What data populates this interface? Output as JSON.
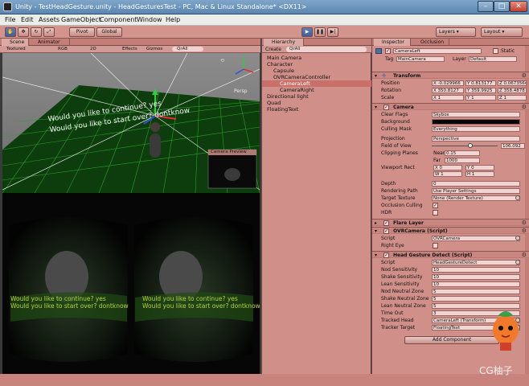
{
  "window": {
    "title": "Unity - TestHeadGesture.unity - HeadGesturesTest - PC, Mac & Linux Standalone* <DX11>"
  },
  "menu": [
    "File",
    "Edit",
    "Assets",
    "GameObject",
    "Component",
    "Window",
    "Help"
  ],
  "toolbar": {
    "pivot": "Pivot",
    "global": "Global",
    "layers": "Layers",
    "layout": "Layout"
  },
  "scene": {
    "tabs": [
      "Scene",
      "Animator"
    ],
    "options": {
      "shading": "Textured",
      "render": "RGB",
      "mode2d": "2D",
      "effects": "Effects",
      "gizmos": "Gizmos",
      "search": "QrAll"
    },
    "persp": "Persp",
    "text_line1": "Would you like to continue? yes",
    "text_line2": "Would you like to start over? dontknow",
    "camera_preview": "Camera Preview"
  },
  "game": {
    "left_line1": "Would you like to continue? yes",
    "left_line2": "Would you like to start over? dontknow",
    "right_line1": "Would you like to continue? yes",
    "right_line2": "Would you like to start over? dontknow"
  },
  "hierarchy": {
    "tab": "Hierarchy",
    "create": "Create",
    "search": "QrAll",
    "items": [
      {
        "label": "Main Camera"
      },
      {
        "label": "Character"
      },
      {
        "label": "Capsule"
      },
      {
        "label": "OVRCameraController"
      },
      {
        "label": "CameraLeft"
      },
      {
        "label": "CameraRight"
      },
      {
        "label": "Directional light"
      },
      {
        "label": "Quad"
      },
      {
        "label": "FloatingText"
      }
    ]
  },
  "inspector": {
    "tabs": [
      "Inspector",
      "Occlusion"
    ],
    "object_name": "CameraLeft",
    "static": "Static",
    "tag_label": "Tag",
    "tag_value": "MainCamera",
    "layer_label": "Layer",
    "layer_value": "Default",
    "transform": {
      "title": "Transform",
      "position_label": "Position",
      "rotation_label": "Rotation",
      "scale_label": "Scale",
      "position": [
        "X -0.029966",
        "Y 0.813177",
        "Z 0.0673564"
      ],
      "rotation": [
        "X 350.8127",
        "Y 359.9925",
        "Z 358.4878"
      ],
      "scale": [
        "X 1",
        "Y 1",
        "Z 1"
      ]
    },
    "camera": {
      "title": "Camera",
      "clear_flags_label": "Clear Flags",
      "clear_flags": "Skybox",
      "background_label": "Background",
      "culling_mask_label": "Culling Mask",
      "culling_mask": "Everything",
      "projection_label": "Projection",
      "projection": "Perspective",
      "fov_label": "Field of View",
      "fov": "106.092",
      "fov_fraction": 0.55,
      "clipping_label": "Clipping Planes",
      "near_label": "Near",
      "near": "0.15",
      "far_label": "Far",
      "far": "1000",
      "viewport_label": "Viewport Rect",
      "vp_x": "X 0",
      "vp_y": "Y 0",
      "vp_w": "W 1",
      "vp_h": "H 1",
      "depth_label": "Depth",
      "depth": "0",
      "rendering_path_label": "Rendering Path",
      "rendering_path": "Use Player Settings",
      "target_texture_label": "Target Texture",
      "target_texture": "None (Render Texture)",
      "occlusion_label": "Occlusion Culling",
      "hdr_label": "HDR"
    },
    "flare_layer": "Flare Layer",
    "ovr_camera": {
      "title": "OVRCamera (Script)",
      "script_label": "Script",
      "script": "OVRCamera",
      "right_eye_label": "Right Eye"
    },
    "head_gesture": {
      "title": "Head Gesture Detect (Script)",
      "rows": [
        {
          "label": "Script",
          "value": "HeadGestureDetect"
        },
        {
          "label": "Nod Sensitivity",
          "value": "10"
        },
        {
          "label": "Shake Sensitivity",
          "value": "10"
        },
        {
          "label": "Lean Sensitivity",
          "value": "10"
        },
        {
          "label": "Nod Neutral Zone",
          "value": "5"
        },
        {
          "label": "Shake Neutral Zone",
          "value": "5"
        },
        {
          "label": "Lean Neutral Zone",
          "value": "5"
        },
        {
          "label": "Time Out",
          "value": "3"
        },
        {
          "label": "Tracked Head",
          "value": "CameraLeft (Transform)"
        },
        {
          "label": "Tracker Target",
          "value": "FloatingText"
        }
      ]
    },
    "add_component": "Add Component"
  },
  "watermark": "CG柚子",
  "colors": {
    "tint": "#d08f89",
    "selection": "#c9706a",
    "grid": "#1f8a1f",
    "game_text": "#b8d23a"
  }
}
